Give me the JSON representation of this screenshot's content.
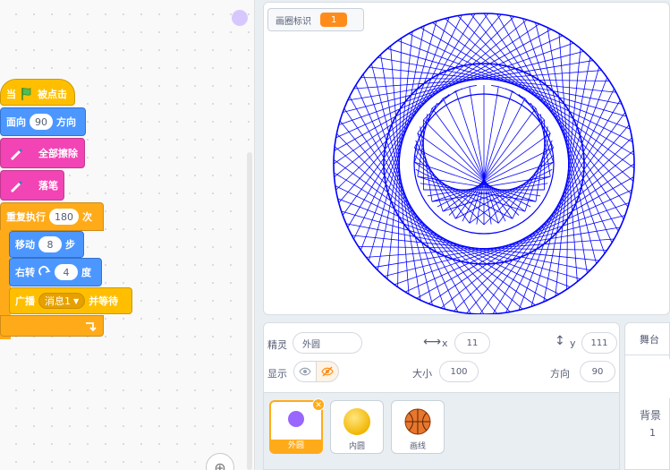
{
  "blocks": {
    "when_flag": {
      "prefix": "当",
      "suffix": "被点击"
    },
    "point": {
      "label": "面向",
      "value": "90",
      "suffix": "方向"
    },
    "erase": {
      "label": "全部擦除"
    },
    "pen_down": {
      "label": "落笔"
    },
    "repeat": {
      "label": "重复执行",
      "value": "180",
      "suffix": "次"
    },
    "move": {
      "label": "移动",
      "value": "8",
      "suffix": "步"
    },
    "turn": {
      "label": "右转",
      "value": "4",
      "suffix": "度"
    },
    "broadcast": {
      "label": "广播",
      "message": "消息1",
      "suffix": "并等待"
    }
  },
  "stage": {
    "monitor_label": "画圈标识",
    "monitor_value": "1"
  },
  "sprite_info": {
    "sprite_label": "精灵",
    "sprite_name": "外圆",
    "x_label": "x",
    "x_value": "11",
    "y_label": "y",
    "y_value": "111",
    "show_label": "显示",
    "size_label": "大小",
    "size_value": "100",
    "direction_label": "方向",
    "direction_value": "90"
  },
  "sprites": [
    {
      "name": "外圆",
      "selected": true
    },
    {
      "name": "内圆",
      "selected": false
    },
    {
      "name": "画线",
      "selected": false
    }
  ],
  "stage_panel": {
    "tab_label": "舞台",
    "backdrops_label": "背景",
    "backdrops_count": "1"
  },
  "colors": {
    "events": "#ffbf00",
    "motion": "#4c97ff",
    "pen": "#f244b4",
    "control": "#ffab19",
    "drawing": "#0000ff"
  }
}
